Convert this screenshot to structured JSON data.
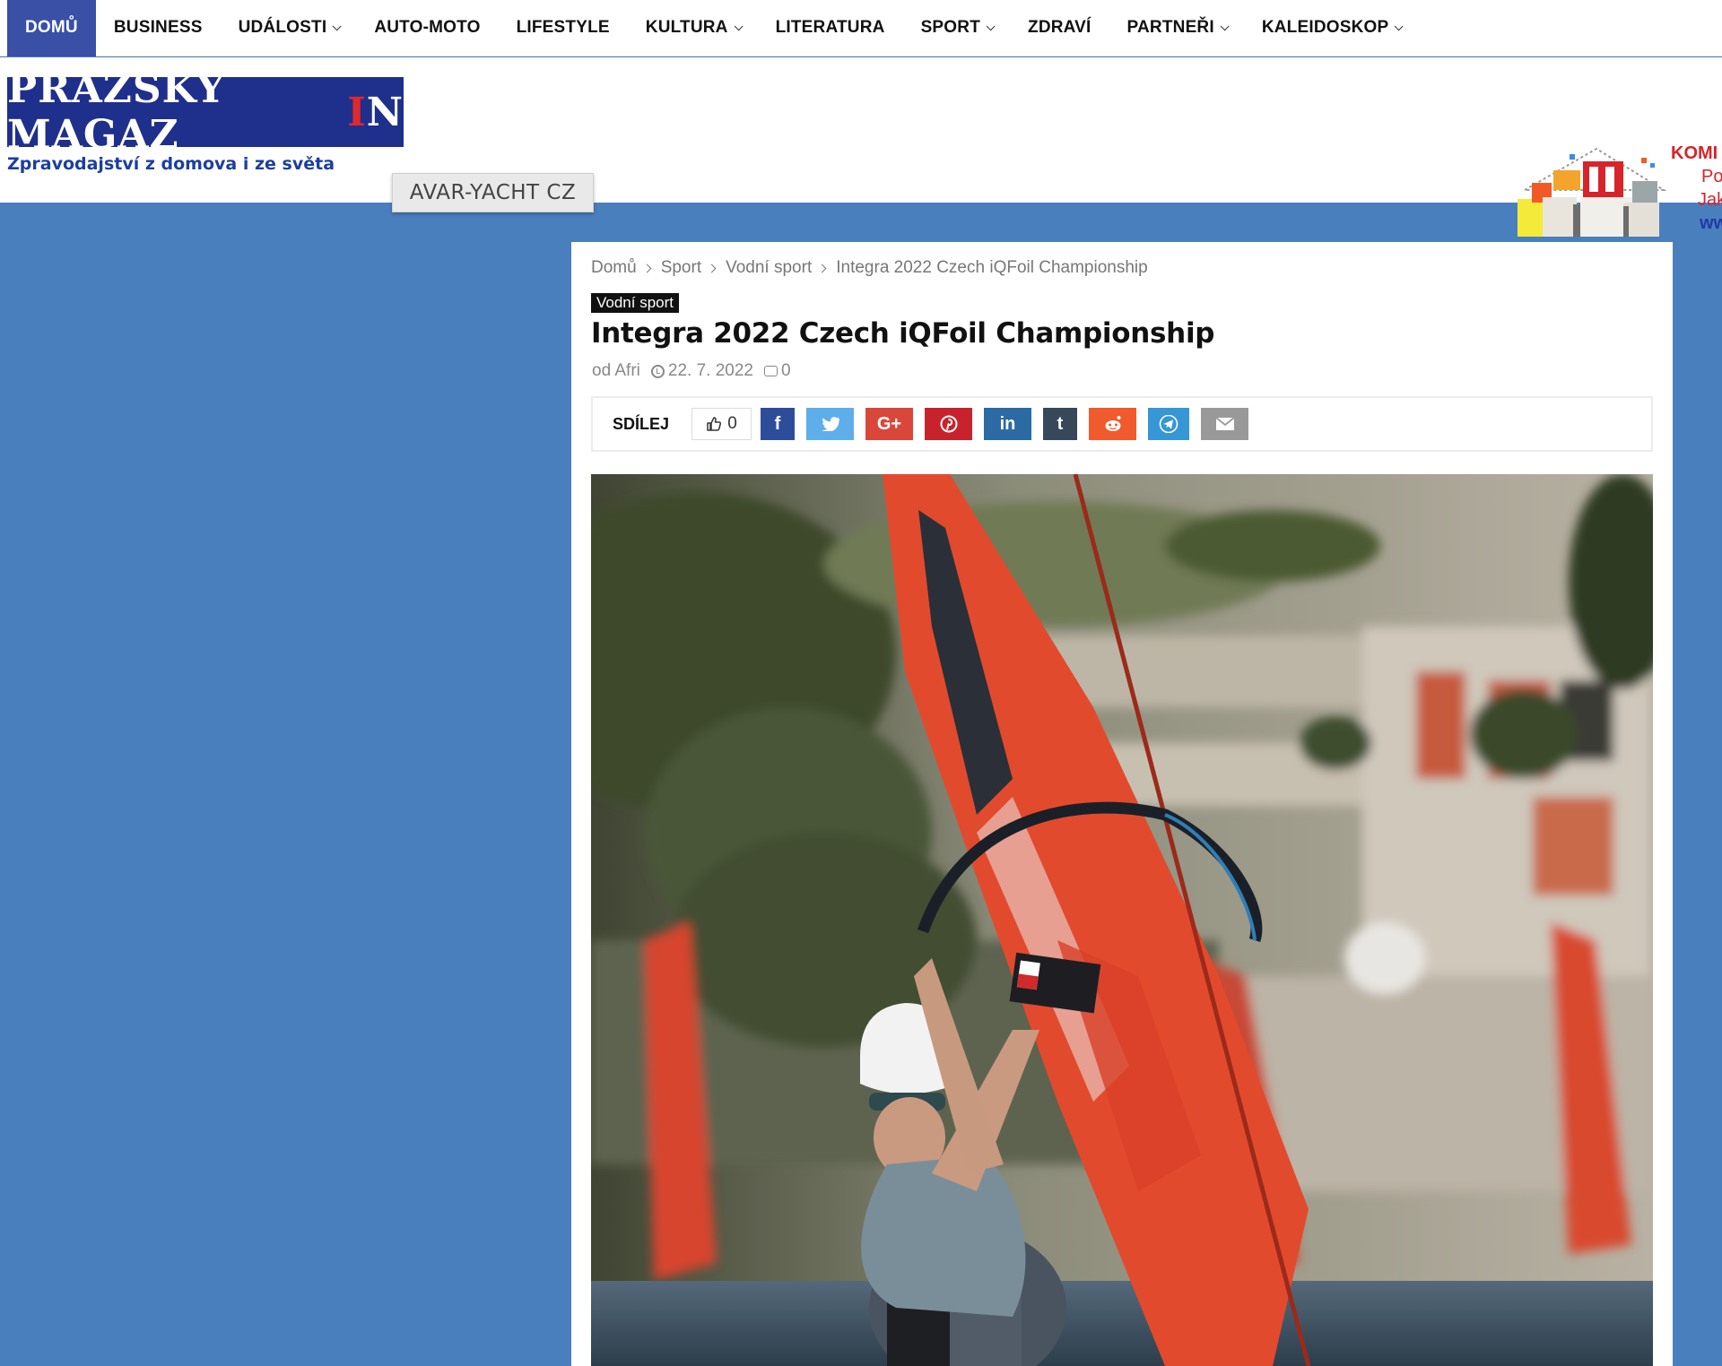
{
  "nav": {
    "items": [
      {
        "label": "DOMŮ",
        "active": true,
        "dropdown": false
      },
      {
        "label": "BUSINESS",
        "dropdown": false
      },
      {
        "label": "UDÁLOSTI",
        "dropdown": true
      },
      {
        "label": "AUTO-MOTO",
        "dropdown": false
      },
      {
        "label": "LIFESTYLE",
        "dropdown": false
      },
      {
        "label": "KULTURA",
        "dropdown": true
      },
      {
        "label": "LITERATURA",
        "dropdown": false
      },
      {
        "label": "SPORT",
        "dropdown": true
      },
      {
        "label": "ZDRAVÍ",
        "dropdown": false
      },
      {
        "label": "PARTNEŘI",
        "dropdown": true
      },
      {
        "label": "KALEIDOSKOP",
        "dropdown": true
      }
    ]
  },
  "header": {
    "logo_part1": "PRAŽSKÝ MAGAZ",
    "logo_red": "I",
    "logo_part2": "N",
    "tagline": "Zpravodajství z domova i ze světa",
    "tooltip": "AVAR-YACHT CZ"
  },
  "ad": {
    "line1": "KOMI",
    "line2": "Po",
    "line3": "Jak",
    "line4": "ww"
  },
  "breadcrumb": [
    "Domů",
    "Sport",
    "Vodní sport",
    "Integra 2022 Czech iQFoil Championship"
  ],
  "article": {
    "category": "Vodní sport",
    "title": "Integra 2022 Czech iQFoil Championship",
    "author": "od Afri",
    "date": "22. 7. 2022",
    "comments": "0"
  },
  "share": {
    "label": "SDÍLEJ",
    "likes": "0",
    "buttons": [
      {
        "name": "facebook-icon",
        "glyph": "f",
        "color": "#2d4d9a"
      },
      {
        "name": "twitter-icon",
        "glyph": "t",
        "color": "#5eaee9"
      },
      {
        "name": "google-plus-icon",
        "glyph": "G+",
        "color": "#d9473a"
      },
      {
        "name": "pinterest-icon",
        "glyph": "P",
        "color": "#c8232c"
      },
      {
        "name": "linkedin-icon",
        "glyph": "in",
        "color": "#2b6aa3"
      },
      {
        "name": "tumblr-icon",
        "glyph": "t",
        "color": "#364859"
      },
      {
        "name": "reddit-icon",
        "glyph": "r",
        "color": "#f05a2c"
      },
      {
        "name": "telegram-icon",
        "glyph": "➤",
        "color": "#3796d6"
      },
      {
        "name": "email-icon",
        "glyph": "✉",
        "color": "#999999"
      }
    ]
  }
}
